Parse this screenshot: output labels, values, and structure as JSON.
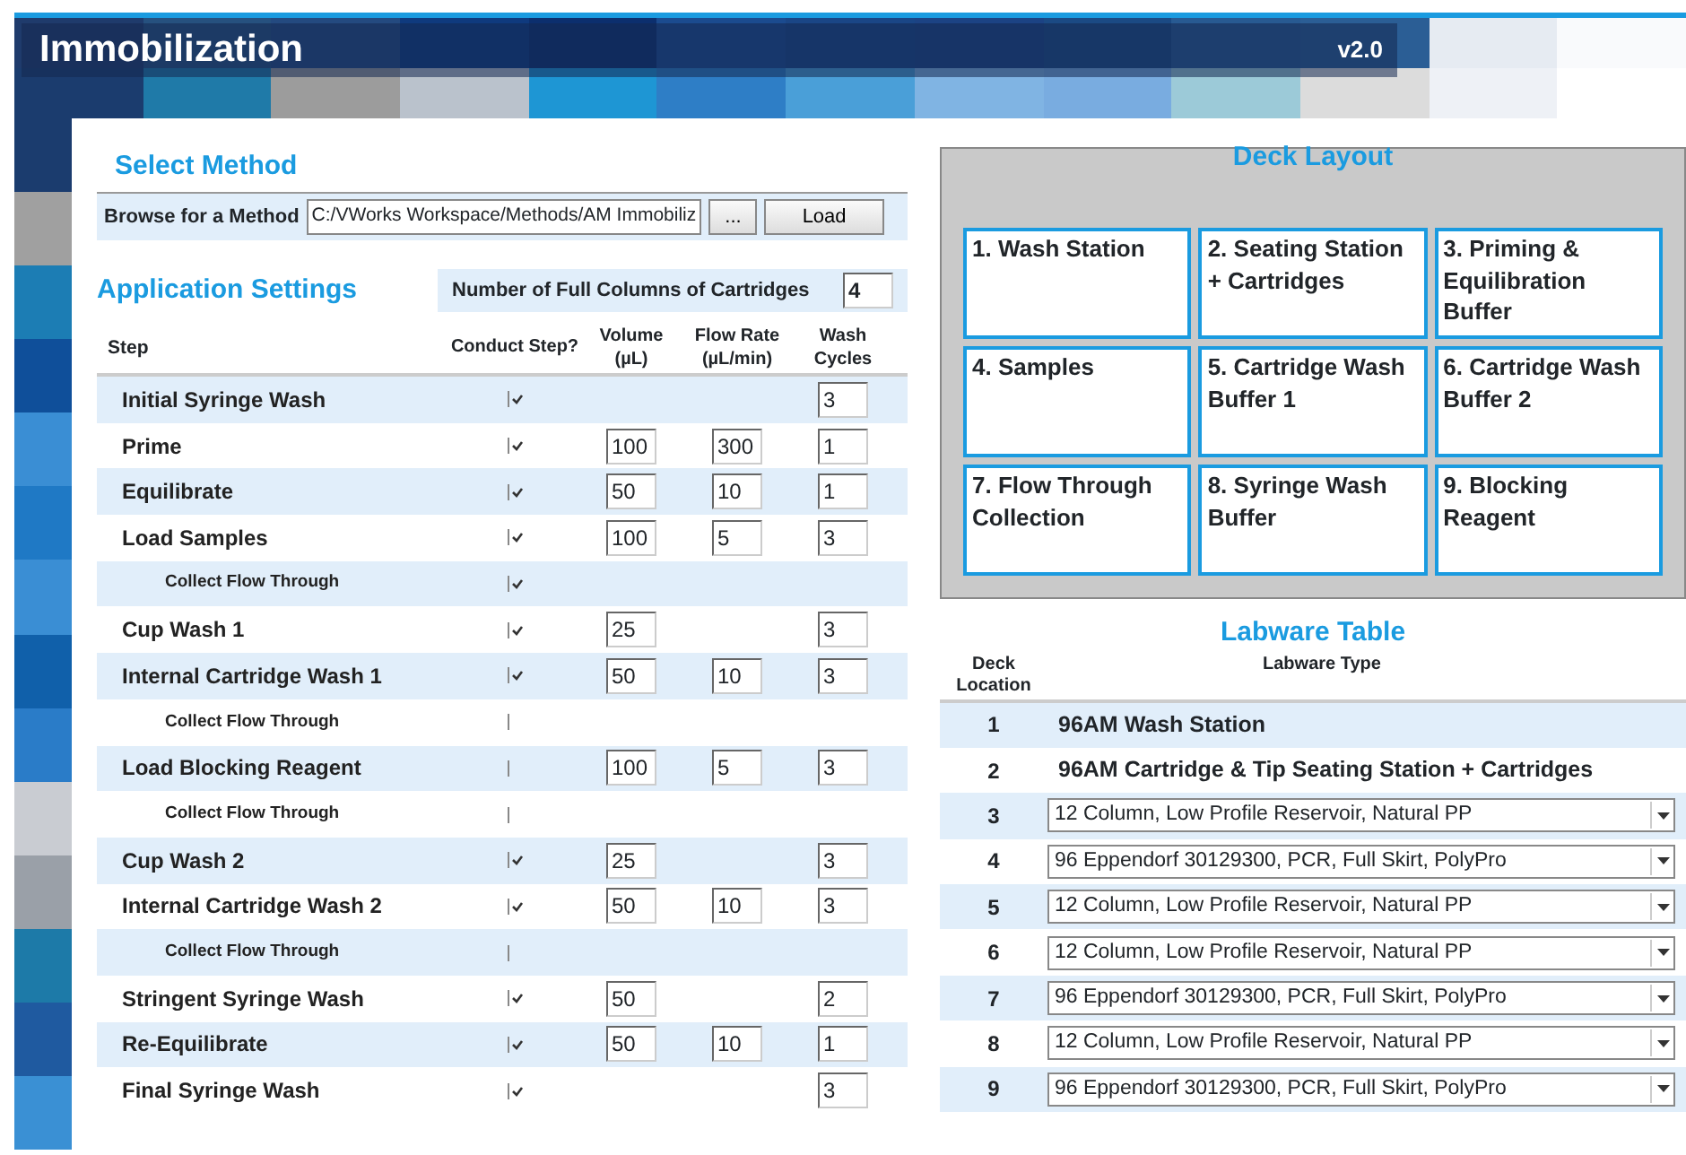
{
  "header": {
    "title": "Immobilization",
    "version": "v2.0"
  },
  "select_method": {
    "heading": "Select Method",
    "label": "Browse for a Method",
    "path": "C:/VWorks Workspace/Methods/AM Immobiliz",
    "browse_button": "...",
    "load_button": "Load"
  },
  "application_settings": {
    "heading": "Application Settings",
    "columns_label": "Number of Full Columns of Cartridges",
    "columns_value": "4",
    "columns": [
      "Step",
      "Conduct Step?",
      "Volume (µL)",
      "Flow Rate (µL/min)",
      "Wash Cycles"
    ],
    "steps": [
      {
        "kind": "step",
        "name": "Initial Syringe Wash",
        "checked": true,
        "wash_cycles": "3"
      },
      {
        "kind": "step",
        "name": "Prime",
        "checked": true,
        "volume": "100",
        "flow_rate": "300",
        "wash_cycles": "1"
      },
      {
        "kind": "step",
        "name": "Equilibrate",
        "checked": true,
        "volume": "50",
        "flow_rate": "10",
        "wash_cycles": "1"
      },
      {
        "kind": "step",
        "name": "Load Samples",
        "checked": true,
        "volume": "100",
        "flow_rate": "5",
        "wash_cycles": "3"
      },
      {
        "kind": "sub",
        "name": "Collect Flow Through",
        "checked": true
      },
      {
        "kind": "step",
        "name": "Cup Wash 1",
        "checked": true,
        "volume": "25",
        "wash_cycles": "3"
      },
      {
        "kind": "step",
        "name": "Internal Cartridge Wash 1",
        "checked": true,
        "volume": "50",
        "flow_rate": "10",
        "wash_cycles": "3"
      },
      {
        "kind": "sub",
        "name": "Collect Flow Through",
        "checked": false
      },
      {
        "kind": "step",
        "name": "Load Blocking Reagent",
        "checked": false,
        "volume": "100",
        "flow_rate": "5",
        "wash_cycles": "3"
      },
      {
        "kind": "sub",
        "name": "Collect Flow Through",
        "checked": false
      },
      {
        "kind": "step",
        "name": "Cup Wash 2",
        "checked": true,
        "volume": "25",
        "wash_cycles": "3"
      },
      {
        "kind": "step",
        "name": "Internal Cartridge Wash 2",
        "checked": true,
        "volume": "50",
        "flow_rate": "10",
        "wash_cycles": "3"
      },
      {
        "kind": "sub",
        "name": "Collect Flow Through",
        "checked": false
      },
      {
        "kind": "step",
        "name": "Stringent Syringe Wash",
        "checked": true,
        "volume": "50",
        "wash_cycles": "2"
      },
      {
        "kind": "step",
        "name": "Re-Equilibrate",
        "checked": true,
        "volume": "50",
        "flow_rate": "10",
        "wash_cycles": "1"
      },
      {
        "kind": "step",
        "name": "Final Syringe Wash",
        "checked": true,
        "wash_cycles": "3"
      }
    ]
  },
  "deck_layout": {
    "heading": "Deck Layout",
    "slots": [
      {
        "number": "1.",
        "label": "Wash Station"
      },
      {
        "number": "2.",
        "label": "Seating Station + Cartridges"
      },
      {
        "number": "3.",
        "label": "Priming & Equilibration Buffer"
      },
      {
        "number": "4.",
        "label": "Samples"
      },
      {
        "number": "5.",
        "label": "Cartridge Wash Buffer 1"
      },
      {
        "number": "6.",
        "label": "Cartridge Wash Buffer 2"
      },
      {
        "number": "7.",
        "label": "Flow Through Collection"
      },
      {
        "number": "8.",
        "label": "Syringe Wash Buffer"
      },
      {
        "number": "9.",
        "label": "Blocking Reagent"
      }
    ]
  },
  "labware_table": {
    "heading": "Labware Table",
    "columns": [
      "Deck Location",
      "Labware Type"
    ],
    "rows": [
      {
        "location": "1",
        "kind": "fixed",
        "labware": "96AM Wash Station"
      },
      {
        "location": "2",
        "kind": "fixed",
        "labware": "96AM Cartridge & Tip Seating Station + Cartridges"
      },
      {
        "location": "3",
        "kind": "select",
        "labware": "12 Column, Low Profile Reservoir, Natural PP"
      },
      {
        "location": "4",
        "kind": "select",
        "labware": "96 Eppendorf 30129300, PCR, Full Skirt, PolyPro"
      },
      {
        "location": "5",
        "kind": "select",
        "labware": "12 Column, Low Profile Reservoir, Natural PP"
      },
      {
        "location": "6",
        "kind": "select",
        "labware": "12 Column, Low Profile Reservoir, Natural PP"
      },
      {
        "location": "7",
        "kind": "select",
        "labware": "96 Eppendorf 30129300, PCR, Full Skirt, PolyPro"
      },
      {
        "location": "8",
        "kind": "select",
        "labware": "12 Column, Low Profile Reservoir, Natural PP"
      },
      {
        "location": "9",
        "kind": "select",
        "labware": "96 Eppendorf 30129300, PCR, Full Skirt, PolyPro"
      }
    ]
  }
}
